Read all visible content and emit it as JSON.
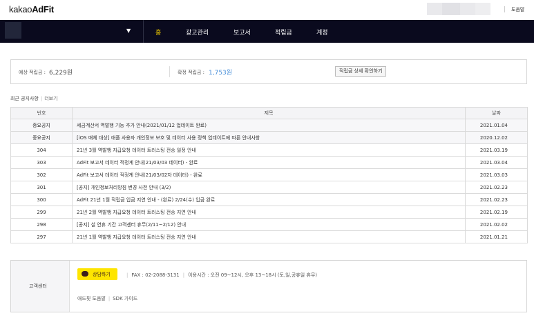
{
  "header": {
    "logo_light": "kakao",
    "logo_bold": "AdFit",
    "help": "도움말"
  },
  "nav": {
    "items": [
      "홈",
      "광고관리",
      "보고서",
      "적립금",
      "계정"
    ],
    "active_index": 0,
    "caret": "▼"
  },
  "summary": {
    "expected_label": "예상 적립금 :",
    "expected_value": "6,229원",
    "confirmed_label": "확정 적립금 :",
    "confirmed_value": "1,753원",
    "detail_button": "적립금 상세 확인하기"
  },
  "notices": {
    "heading": "최근 공지사항",
    "more": "더보기",
    "columns": [
      "번호",
      "제목",
      "날짜"
    ],
    "rows": [
      {
        "no": "중요공지",
        "title": "세금계산서 역발행 기능 추가 안내(2021/01/12 업데이트 완료)",
        "date": "2021.01.04",
        "pinned": true
      },
      {
        "no": "중요공지",
        "title": "[iOS 매체 대상] 애플 사용자 개인정보 보호 및 데이터 사용 정책 업데이트에 따른 안내사항",
        "date": "2020.12.02",
        "pinned": true
      },
      {
        "no": "304",
        "title": "21년 3월 역발행 지급요청 데이터 트러스팅 전송 일정 안내",
        "date": "2021.03.19",
        "pinned": false
      },
      {
        "no": "303",
        "title": "AdFit 보고서 데이터 적정계 안내(21/03/03 데이터) - 완료",
        "date": "2021.03.04",
        "pinned": false
      },
      {
        "no": "302",
        "title": "AdFit 보고서 데이터 적정계 안내(21/03/02자 데이터) - 완료",
        "date": "2021.03.03",
        "pinned": false
      },
      {
        "no": "301",
        "title": "[공지] 개인정보처리방침 변경 사전 안내 (3/2)",
        "date": "2021.02.23",
        "pinned": false
      },
      {
        "no": "300",
        "title": "AdFit 21년 1월 적립금 입금 지연 안내 - (완료) 2/24(수) 입금 완료",
        "date": "2021.02.23",
        "pinned": false
      },
      {
        "no": "299",
        "title": "21년 2월 역발행 지급요청 데이터 트러스팅 전송 지연 안내",
        "date": "2021.02.19",
        "pinned": false
      },
      {
        "no": "298",
        "title": "[공지] 설 연휴 기간 고객센터 휴무(2/11~2/12) 안내",
        "date": "2021.02.02",
        "pinned": false
      },
      {
        "no": "297",
        "title": "21년 1월 역발행 지급요청 데이터 트러스팅 전송 지연 안내",
        "date": "2021.01.21",
        "pinned": false
      }
    ]
  },
  "support": {
    "label": "고객센터",
    "chat_button": "상담하기",
    "fax": "FAX : 02-2088-3131",
    "hours": "이용시간 : 오전 09~12시, 오후 13~18시 (토,일,공휴일 휴무)",
    "links": [
      "애드핏 도움말",
      "SDK 가이드"
    ]
  },
  "colors": {
    "nav_bg": "#0a0a1e",
    "nav_active": "#f7d100",
    "value_blue": "#4a90d9",
    "kakao_yellow": "#fee500"
  }
}
